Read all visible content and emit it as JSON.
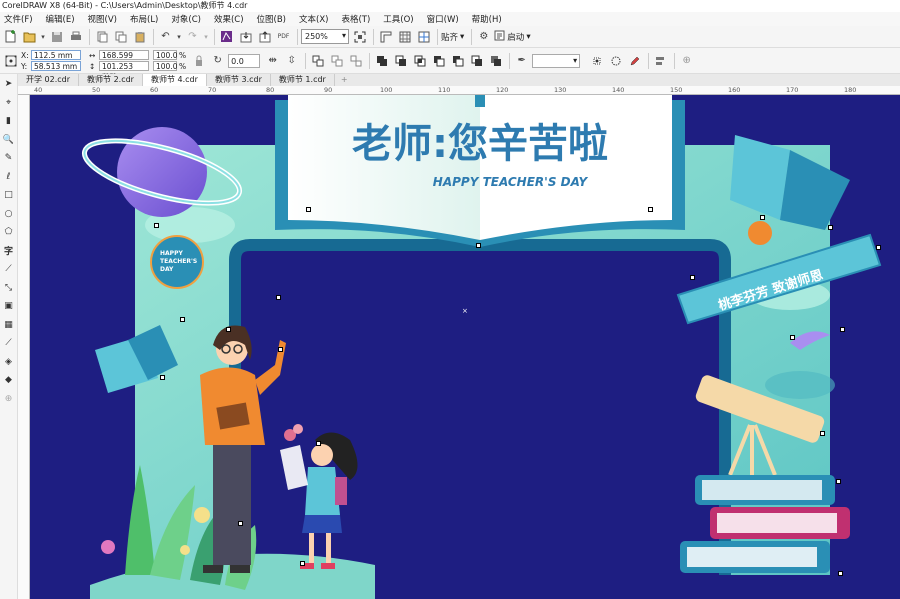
{
  "window": {
    "title": "CorelDRAW X8 (64-Bit) - C:\\Users\\Admin\\Desktop\\教师节 4.cdr"
  },
  "menu": [
    "文件(F)",
    "编辑(E)",
    "视图(V)",
    "布局(L)",
    "对象(C)",
    "效果(C)",
    "位图(B)",
    "文本(X)",
    "表格(T)",
    "工具(O)",
    "窗口(W)",
    "帮助(H)"
  ],
  "toolbar": {
    "zoom": "250%",
    "snap_label": "贴齐",
    "launch_label": "启动",
    "pdf_label": "PDF"
  },
  "properties": {
    "x": "112.5 mm",
    "y": "58.513 mm",
    "width": "168.599 mm",
    "height": "101.253 mm",
    "scale_x": "100.0",
    "scale_y": "100.0",
    "rotation": "0.0"
  },
  "tabs": [
    "开学 02.cdr",
    "教师节 2.cdr",
    "教师节 4.cdr",
    "教师节 3.cdr",
    "教师节 1.cdr"
  ],
  "active_tab": "教师节 4.cdr",
  "ruler": [
    "40",
    "50",
    "60",
    "70",
    "80",
    "90",
    "100",
    "110",
    "120",
    "130",
    "140",
    "150",
    "160",
    "170",
    "180"
  ],
  "design": {
    "title_cn": "老师:您辛苦啦",
    "title_en": "HAPPY TEACHER'S DAY",
    "badge_line1": "HAPPY",
    "badge_line2": "TEACHER'S",
    "badge_line3": "DAY",
    "ribbon": "桃李芬芳 致谢师恩"
  },
  "colors": {
    "canvas_bg": "#1e1e82",
    "frame_mint": "#7fd6c9",
    "frame_teal": "#1a6d96",
    "title_blue": "#2e7bb0"
  }
}
